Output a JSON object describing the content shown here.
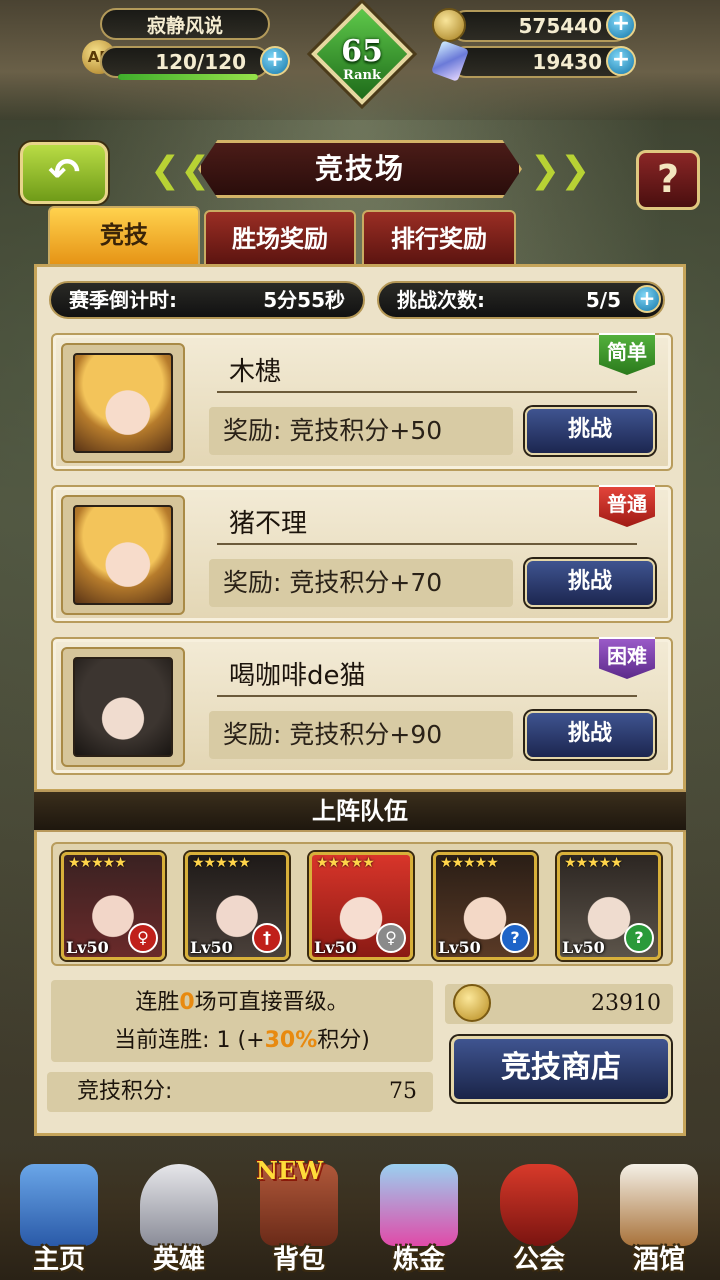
{
  "player": {
    "name": "寂静风说",
    "ap_icon_text": "AP",
    "ap": "120/120",
    "ap_fraction": 1.0,
    "gold": "575440",
    "gems": "19430",
    "rank_number": "65",
    "rank_label": "Rank"
  },
  "header": {
    "title": "竞技场",
    "back_glyph": "↶",
    "help_glyph": "?"
  },
  "tabs": [
    {
      "label": "竞技",
      "active": true
    },
    {
      "label": "胜场奖励",
      "active": false
    },
    {
      "label": "排行奖励",
      "active": false
    }
  ],
  "season": {
    "label": "赛季倒计时:",
    "value": "5分55秒"
  },
  "tries": {
    "label": "挑战次数:",
    "value": "5/5"
  },
  "opponents": [
    {
      "name": "木槵",
      "difficulty": "简单",
      "reward": "奖励: 竞技积分+50",
      "button": "挑战"
    },
    {
      "name": "猪不理",
      "difficulty": "普通",
      "reward": "奖励: 竞技积分+70",
      "button": "挑战"
    },
    {
      "name": "喝咖啡de猫",
      "difficulty": "困难",
      "reward": "奖励: 竞技积分+90",
      "button": "挑战"
    }
  ],
  "team": {
    "title": "上阵队伍",
    "heroes": [
      {
        "level": "Lv50",
        "stars": "★★★★★"
      },
      {
        "level": "Lv50",
        "stars": "★★★★★"
      },
      {
        "level": "Lv50",
        "stars": "★★★★★"
      },
      {
        "level": "Lv50",
        "stars": "★★★★★"
      },
      {
        "level": "Lv50",
        "stars": "★★★★★"
      }
    ]
  },
  "streak": {
    "line1_a": "连胜",
    "line1_num": "0",
    "line1_b": "场可直接晋级。",
    "line2_a": "当前连胜: 1 (+",
    "line2_pct": "30%",
    "line2_b": "积分)"
  },
  "arena_points": {
    "label": "竞技积分:",
    "value": "75"
  },
  "arena_coins": "23910",
  "shop_button": "竞技商店",
  "nav": [
    {
      "label": "主页"
    },
    {
      "label": "英雄"
    },
    {
      "label": "背包",
      "tag": "NEW"
    },
    {
      "label": "炼金"
    },
    {
      "label": "公会"
    },
    {
      "label": "酒馆"
    }
  ],
  "colors": {
    "accent_gold": "#d4b468",
    "tab_active": "#f2b22e",
    "tab_inactive": "#7a211a",
    "button_blue": "#2c3c70",
    "easy": "#3f9a2c",
    "normal": "#c8302a",
    "hard": "#7a42aa"
  }
}
